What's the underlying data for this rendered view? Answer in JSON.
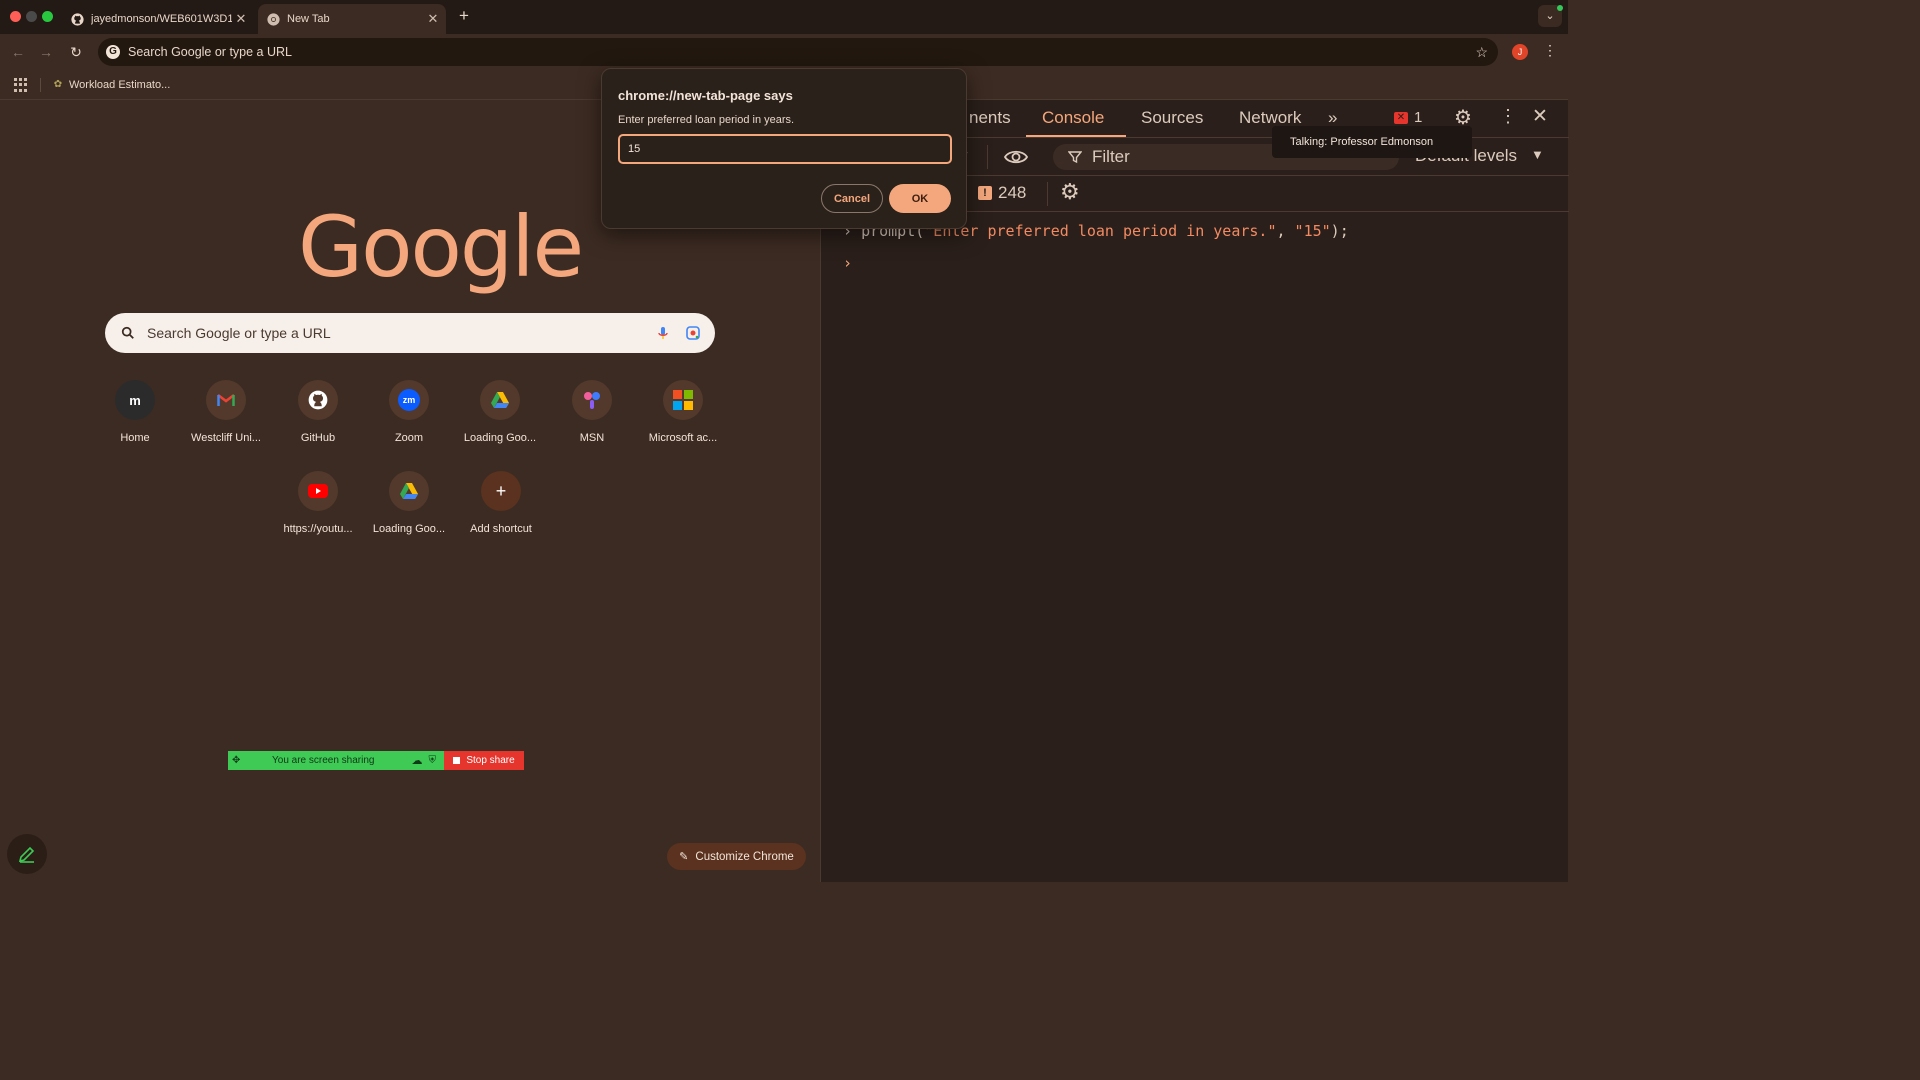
{
  "colors": {
    "accent": "#f4a77c",
    "background": "#3c2b22",
    "devtools_bg": "#2a1f1a",
    "share_green": "#3fc955",
    "share_red": "#e5352d",
    "error_red": "#e5352d"
  },
  "browser": {
    "tabs": [
      {
        "title": "jayedmonson/WEB601W3D1",
        "icon": "github-icon",
        "active": false
      },
      {
        "title": "New Tab",
        "icon": "chrome-icon",
        "active": true
      }
    ],
    "omnibox_placeholder": "Search Google or type a URL",
    "profile_initial": "J",
    "bookmarks": [
      {
        "label": "Workload Estimato...",
        "icon": "leaf-icon"
      }
    ]
  },
  "ntp": {
    "logo": "Google",
    "search_placeholder": "Search Google or type a URL",
    "shortcuts_row1": [
      {
        "label": "Home",
        "icon": "m-icon",
        "glyph": "m"
      },
      {
        "label": "Westcliff Uni...",
        "icon": "gmail-icon",
        "glyph": "M"
      },
      {
        "label": "GitHub",
        "icon": "github-icon",
        "glyph": ""
      },
      {
        "label": "Zoom",
        "icon": "zoom-icon",
        "glyph": "zm"
      },
      {
        "label": "Loading Goo...",
        "icon": "drive-icon",
        "glyph": ""
      },
      {
        "label": "MSN",
        "icon": "msn-icon",
        "glyph": ""
      },
      {
        "label": "Microsoft ac...",
        "icon": "microsoft-icon",
        "glyph": ""
      }
    ],
    "shortcuts_row2": [
      {
        "label": "https://youtu...",
        "icon": "youtube-icon",
        "glyph": ""
      },
      {
        "label": "Loading Goo...",
        "icon": "drive-icon",
        "glyph": ""
      },
      {
        "label": "Add shortcut",
        "icon": "plus-icon",
        "glyph": "+"
      }
    ],
    "share_bar": {
      "status": "You are screen sharing",
      "stop_label": "Stop share"
    },
    "customize_label": "Customize Chrome"
  },
  "devtools": {
    "tabs": [
      "nents",
      "Console",
      "Sources",
      "Network"
    ],
    "active_tab": "Console",
    "error_count": "1",
    "filter_placeholder": "Filter",
    "levels_label": "Default levels",
    "issues_count": "248",
    "console_input": "prompt(\"Enter preferred loan period in years.\", \"15\");",
    "console_fn": "prompt(",
    "console_arg1": "\"Enter preferred loan period in years.\"",
    "console_sep": ", ",
    "console_arg2": "\"15\"",
    "console_end": ");"
  },
  "tooltip": {
    "text": "Talking: Professor Edmonson"
  },
  "dialog": {
    "title": "chrome://new-tab-page says",
    "message": "Enter preferred loan period in years.",
    "input_value": "15",
    "cancel_label": "Cancel",
    "ok_label": "OK"
  }
}
